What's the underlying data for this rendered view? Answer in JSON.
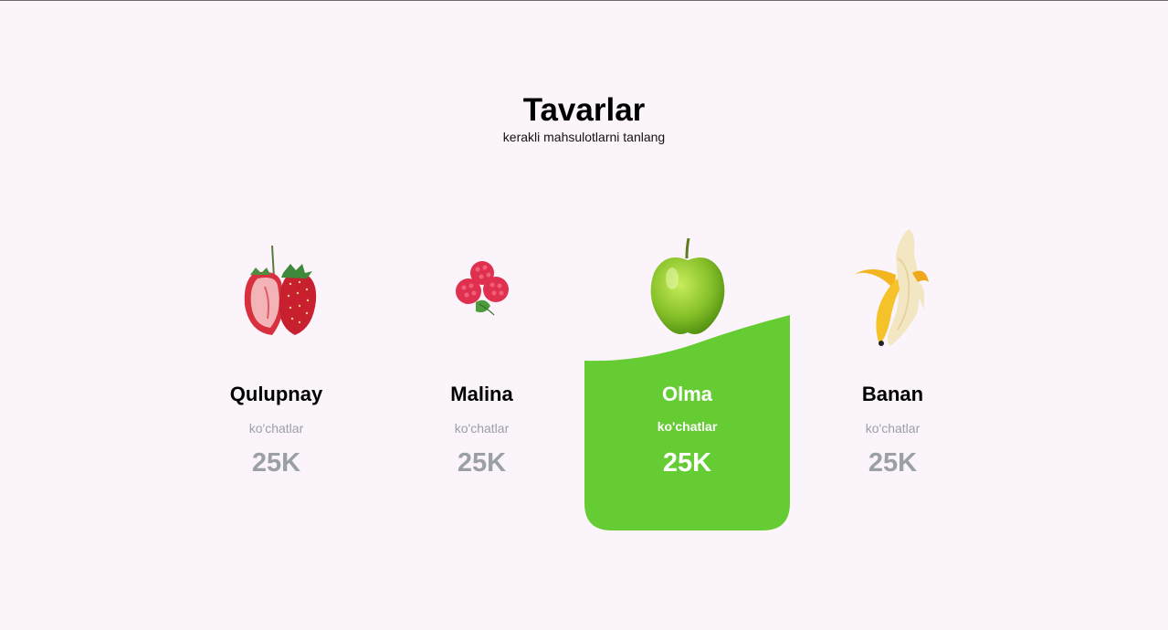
{
  "header": {
    "title": "Tavarlar",
    "subtitle": "kerakli mahsulotlarni tanlang"
  },
  "colors": {
    "background": "#fbf4fb",
    "active_card": "#66cc33",
    "muted_text": "#9aa0a6"
  },
  "products": [
    {
      "name": "Qulupnay",
      "category": "ko'chatlar",
      "price": "25K",
      "icon": "strawberry-icon",
      "active": false
    },
    {
      "name": "Malina",
      "category": "ko'chatlar",
      "price": "25K",
      "icon": "raspberry-icon",
      "active": false
    },
    {
      "name": "Olma",
      "category": "ko'chatlar",
      "price": "25K",
      "icon": "apple-icon",
      "active": true
    },
    {
      "name": "Banan",
      "category": "ko'chatlar",
      "price": "25K",
      "icon": "banana-icon",
      "active": false
    }
  ]
}
